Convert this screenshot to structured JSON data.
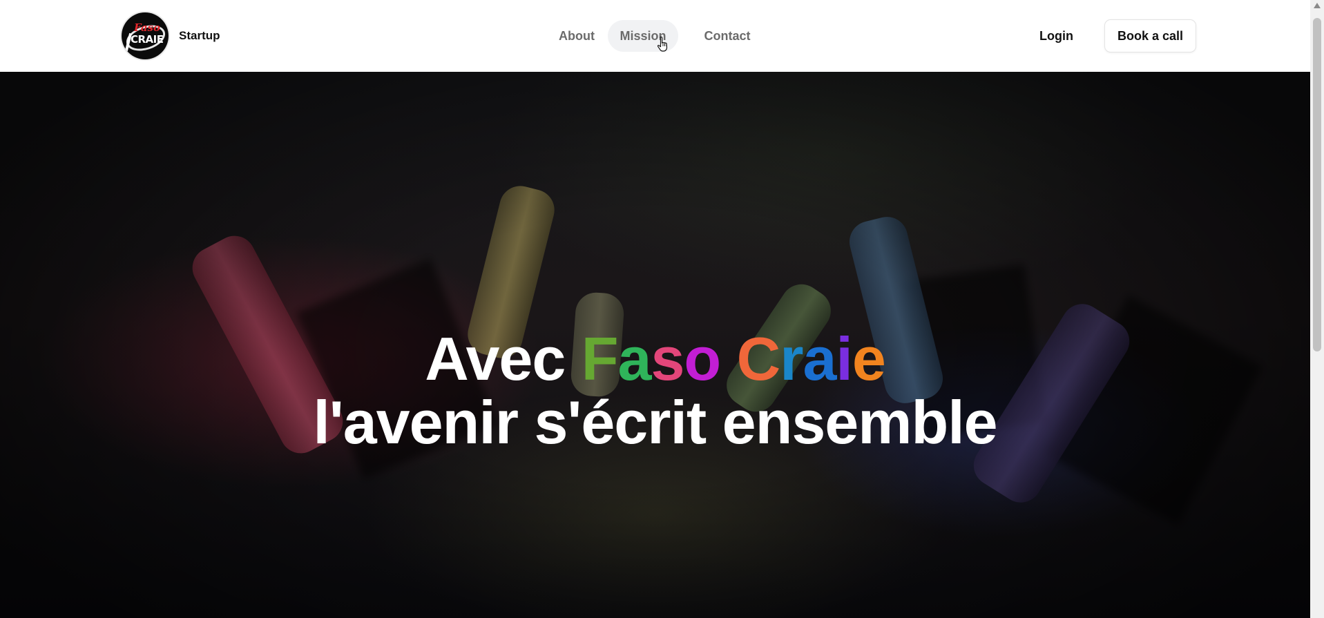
{
  "header": {
    "logo": {
      "name": "faso-craie-logo",
      "text_top": "Faso",
      "text_bottom": "CRAIE"
    },
    "brand": "Startup",
    "nav": [
      {
        "label": "About"
      },
      {
        "label": "Mission",
        "state": "hover"
      },
      {
        "label": "Contact"
      }
    ],
    "login_label": "Login",
    "cta_label": "Book a call"
  },
  "hero": {
    "title_prefix": "Avec",
    "brand_letters": [
      {
        "char": "F",
        "color": "#66a832"
      },
      {
        "char": "a",
        "color": "#2fb45a"
      },
      {
        "char": "s",
        "color": "#e3467a"
      },
      {
        "char": "o",
        "color": "#c21ed4"
      },
      {
        "char": " ",
        "color": "#ffffff"
      },
      {
        "char": "C",
        "color": "#f0673a"
      },
      {
        "char": "r",
        "color": "#1a86c9"
      },
      {
        "char": "a",
        "color": "#1a6fd1"
      },
      {
        "char": "i",
        "color": "#7a2ee0"
      },
      {
        "char": "e",
        "color": "#f2841f"
      }
    ],
    "subtitle": "l'avenir s'écrit ensemble",
    "background": "colored chalk sticks on chalk dust, dark overlay"
  },
  "colors": {
    "header_bg": "#ffffff",
    "nav_text": "#6b6b6b",
    "nav_hover_bg": "#f1f2f4",
    "hero_text": "#ffffff"
  },
  "icons": {
    "cursor": "hand-pointer-icon",
    "scroll_up": "scroll-up-arrow-icon"
  }
}
